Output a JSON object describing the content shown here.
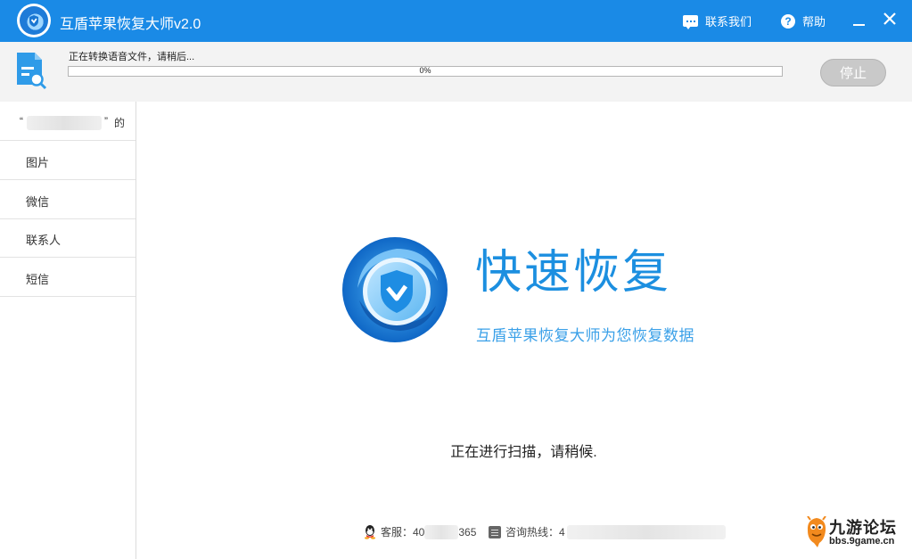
{
  "window": {
    "title": "互盾苹果恢复大师v2.0",
    "contact_label": "联系我们",
    "help_label": "帮助",
    "accent": "#1a8ae6"
  },
  "progress": {
    "status": "正在转换语音文件，请稍后...",
    "percent_text": "0%",
    "value": 0,
    "stop_label": "停止"
  },
  "sidebar": {
    "device": {
      "open_quote": "“",
      "close_quote": "”",
      "suffix": "的"
    },
    "items": [
      {
        "label": "图片"
      },
      {
        "label": "微信"
      },
      {
        "label": "联系人"
      },
      {
        "label": "短信"
      }
    ]
  },
  "main": {
    "headline": "快速恢复",
    "subline": "互盾苹果恢复大师为您恢复数据",
    "scan_status": "正在进行扫描，请稍候."
  },
  "footer": {
    "service_prefix": "客服：40",
    "service_suffix": "365",
    "hotline_prefix": "咨询热线：4"
  },
  "watermark": {
    "title": "九游论坛",
    "url": "bbs.9game.cn"
  },
  "icons": {
    "app_logo": "shield-check-logo",
    "contact": "chat-icon",
    "help": "question-icon",
    "minimize": "minimize-icon",
    "close": "close-icon",
    "task": "document-search-icon",
    "service": "qq-icon",
    "hotline": "phone-icon"
  }
}
